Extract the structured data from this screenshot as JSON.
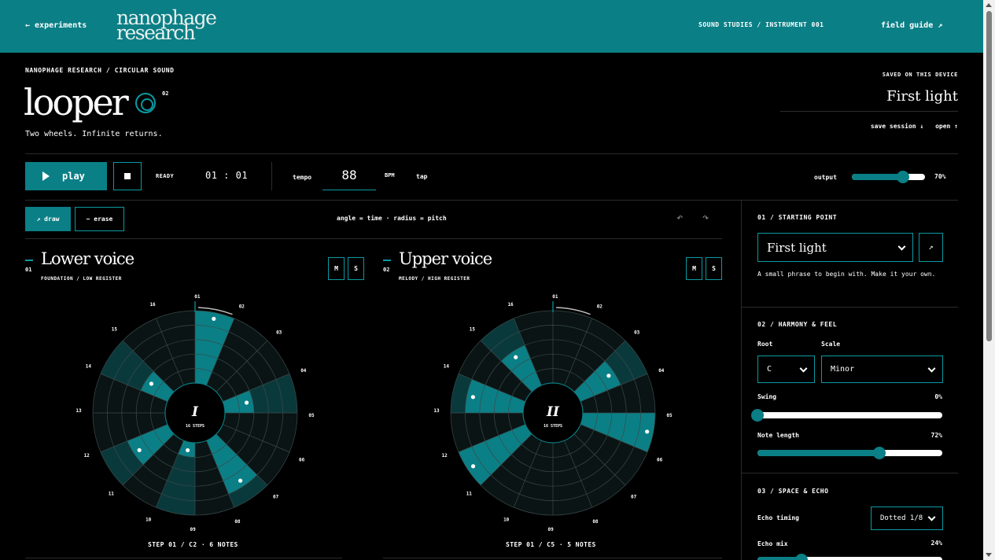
{
  "topbar": {
    "back_link": "← experiments",
    "logo_line1": "nanophage",
    "logo_line2": "research",
    "breadcrumb": "SOUND STUDIES / INSTRUMENT 001",
    "field_guide": "field guide ↗"
  },
  "header": {
    "eyebrow": "NANOPHAGE RESEARCH / CIRCULAR SOUND",
    "title": "looper",
    "title_number": "02",
    "tagline": "Two wheels. Infinite returns.",
    "saved_label": "SAVED ON THIS DEVICE",
    "session_name": "First light",
    "save_session": "save session ↓",
    "open": "open ↑"
  },
  "transport": {
    "play_label": "play",
    "status": "READY",
    "clock": "01 : 01",
    "tempo_label": "tempo",
    "tempo_value": "88",
    "bpm_label": "BPM",
    "tap_label": "tap",
    "output_label": "output",
    "output_value": "70%",
    "output_level": 0.7
  },
  "tools": {
    "draw": "↗ draw",
    "erase": "− erase",
    "legend": "angle = time · radius = pitch"
  },
  "voices": [
    {
      "num": "01",
      "name": "Lower voice",
      "subtitle": "FOUNDATION / LOW REGISTER",
      "mute": "M",
      "solo": "S",
      "roman": "I",
      "steps_label": "16 STEPS",
      "status": "STEP 01 / C2 · 6 NOTES",
      "step_labels": [
        "01",
        "02",
        "03",
        "04",
        "05",
        "06",
        "07",
        "08",
        "09",
        "10",
        "11",
        "12",
        "13",
        "14",
        "15",
        "16"
      ],
      "notes": [
        {
          "step": 1,
          "level": 5
        },
        {
          "step": 4,
          "level": 2
        },
        {
          "step": 7,
          "level": 4
        },
        {
          "step": 9,
          "level": 1
        },
        {
          "step": 11,
          "level": 3
        },
        {
          "step": 14,
          "level": 2
        }
      ]
    },
    {
      "num": "02",
      "name": "Upper voice",
      "subtitle": "MELODY / HIGH REGISTER",
      "mute": "M",
      "solo": "S",
      "roman": "II",
      "steps_label": "16 STEPS",
      "status": "STEP 01 / C5 · 5 NOTES",
      "step_labels": [
        "01",
        "02",
        "03",
        "04",
        "05",
        "06",
        "07",
        "08",
        "09",
        "10",
        "11",
        "12",
        "13",
        "14",
        "15",
        "16"
      ],
      "notes": [
        {
          "step": 3,
          "level": 3
        },
        {
          "step": 5,
          "level": 5
        },
        {
          "step": 11,
          "level": 5
        },
        {
          "step": 13,
          "level": 4
        },
        {
          "step": 15,
          "level": 3
        }
      ]
    }
  ],
  "panel": {
    "section1_title": "01 / STARTING POINT",
    "preset_value": "First light",
    "preset_desc": "A small phrase to begin with. Make it your own.",
    "section2_title": "02 / HARMONY & FEEL",
    "root_label": "Root",
    "root_value": "C",
    "scale_label": "Scale",
    "scale_value": "Minor",
    "swing_label": "Swing",
    "swing_value": "0%",
    "swing_level": 0.0,
    "length_label": "Note length",
    "length_value": "72%",
    "length_level": 0.66,
    "section3_title": "03 / SPACE & ECHO",
    "echo_timing_label": "Echo timing",
    "echo_timing_value": "Dotted 1/8",
    "echo_mix_label": "Echo mix",
    "echo_mix_value": "24%",
    "echo_mix_level": 0.24
  },
  "colors": {
    "accent": "#0b7f86",
    "accent_line": "#0b9aa2",
    "wheel_bg": "#0a1414",
    "note_fill": "#0b7f86"
  }
}
